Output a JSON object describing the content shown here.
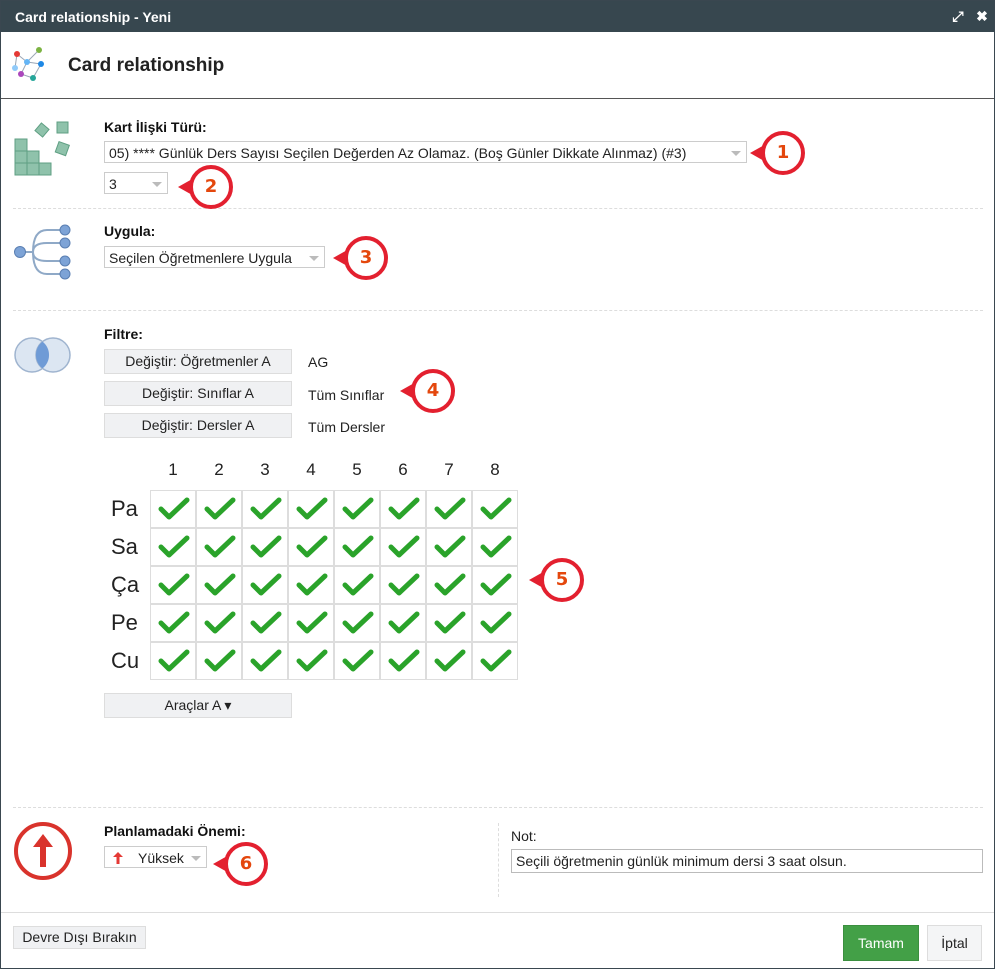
{
  "window": {
    "title": "Card relationship - Yeni",
    "expand_glyph": "⤢",
    "close_glyph": "✖"
  },
  "header": {
    "title": "Card relationship"
  },
  "type_section": {
    "label": "Kart İlişki Türü:",
    "type_value": "05) **** Günlük Ders Sayısı Seçilen Değerden Az Olamaz. (Boş Günler Dikkate Alınmaz) (#3)",
    "count_value": "3"
  },
  "apply_section": {
    "label": "Uygula:",
    "value": "Seçilen Öğretmenlere Uygula"
  },
  "filter_section": {
    "label": "Filtre:",
    "rows": [
      {
        "button": "Değiştir: Öğretmenler A",
        "value": "AG"
      },
      {
        "button": "Değiştir: Sınıflar A",
        "value": "Tüm Sınıflar"
      },
      {
        "button": "Değiştir: Dersler A",
        "value": "Tüm Dersler"
      }
    ]
  },
  "grid": {
    "columns": [
      "1",
      "2",
      "3",
      "4",
      "5",
      "6",
      "7",
      "8"
    ],
    "rows": [
      "Pa",
      "Sa",
      "Ça",
      "Pe",
      "Cu"
    ],
    "check_color": "#2aa32a"
  },
  "tools_button": "Araçlar A ▾",
  "importance": {
    "label": "Planlamadaki Önemi:",
    "value": "Yüksek",
    "arrow_glyph": "🠕",
    "color": "#d9332c"
  },
  "note": {
    "label": "Not:",
    "value": "Seçili öğretmenin günlük minimum dersi 3 saat olsun."
  },
  "footer": {
    "disable_button": "Devre Dışı Bırakın",
    "ok_button": "Tamam",
    "cancel_button": "İptal",
    "ok_color": "#43a047"
  },
  "callouts": [
    "1",
    "2",
    "3",
    "4",
    "5",
    "6"
  ],
  "colors": {
    "titlebar": "#37474f",
    "callout_red": "#e3202f",
    "callout_text": "#e4470d"
  }
}
